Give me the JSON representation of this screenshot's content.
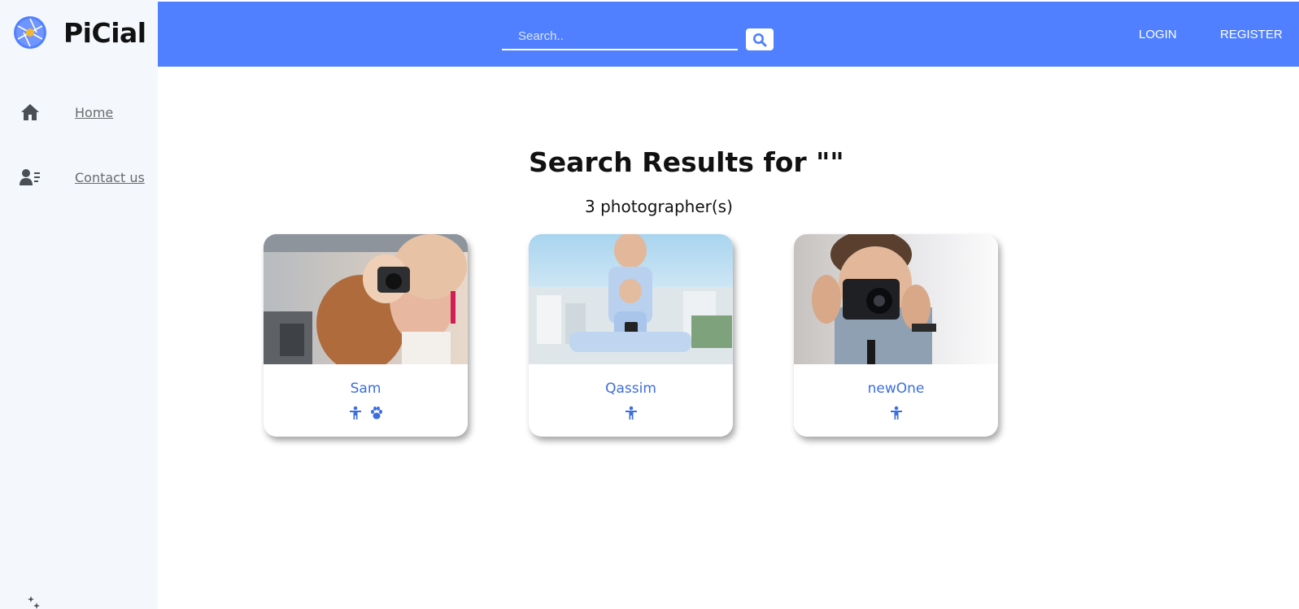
{
  "brand": {
    "name": "PiCial",
    "logo_icon": "aperture-logo-icon"
  },
  "sidebar": {
    "items": [
      {
        "label": "Home",
        "icon": "home-icon"
      },
      {
        "label": "Contact us",
        "icon": "contact-list-icon"
      }
    ]
  },
  "header": {
    "search_placeholder": "Search..",
    "search_value": "",
    "search_button_icon": "search-icon",
    "login_label": "LOGIN",
    "register_label": "REGISTER"
  },
  "main": {
    "title": "Search Results for \"\"",
    "count_text": "3 photographer(s)"
  },
  "photographers": [
    {
      "name": "Sam",
      "tags": [
        "person-icon",
        "paw-icon"
      ]
    },
    {
      "name": "Qassim",
      "tags": [
        "person-icon"
      ]
    },
    {
      "name": "newOne",
      "tags": [
        "person-icon"
      ]
    }
  ],
  "colors": {
    "header_bg": "#5080ff",
    "sidebar_bg": "#f4f8fd",
    "accent_text": "#3c6de0"
  }
}
